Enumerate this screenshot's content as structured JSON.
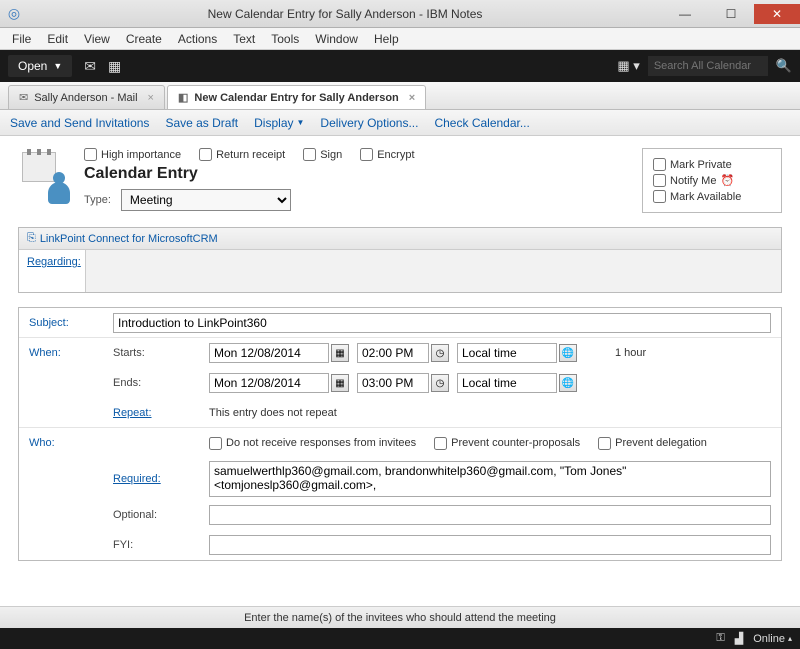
{
  "window": {
    "title": "New Calendar Entry for Sally Anderson - IBM Notes"
  },
  "menu": [
    "File",
    "Edit",
    "View",
    "Create",
    "Actions",
    "Text",
    "Tools",
    "Window",
    "Help"
  ],
  "toolbar": {
    "open_label": "Open",
    "search_placeholder": "Search All Calendar"
  },
  "tabs": [
    {
      "label": "Sally Anderson - Mail",
      "active": false
    },
    {
      "label": "New Calendar Entry for Sally Anderson",
      "active": true
    }
  ],
  "actions": {
    "save_send": "Save and Send Invitations",
    "save_draft": "Save as Draft",
    "display": "Display",
    "delivery": "Delivery Options...",
    "check_cal": "Check Calendar..."
  },
  "header": {
    "checks": {
      "high_importance": "High importance",
      "return_receipt": "Return receipt",
      "sign": "Sign",
      "encrypt": "Encrypt"
    },
    "title": "Calendar Entry",
    "type_label": "Type:",
    "type_value": "Meeting",
    "side": {
      "mark_private": "Mark Private",
      "notify_me": "Notify Me",
      "mark_available": "Mark Available"
    }
  },
  "regarding": {
    "section_title": "LinkPoint Connect for MicrosoftCRM",
    "label": "Regarding:"
  },
  "form": {
    "subject_label": "Subject:",
    "subject_value": "Introduction to LinkPoint360",
    "when_label": "When:",
    "starts_label": "Starts:",
    "ends_label": "Ends:",
    "start_date": "Mon 12/08/2014",
    "start_time": "02:00 PM",
    "end_date": "Mon 12/08/2014",
    "end_time": "03:00 PM",
    "tz": "Local time",
    "duration": "1 hour",
    "repeat_label": "Repeat:",
    "repeat_text": "This entry does not repeat",
    "who_label": "Who:",
    "who_checks": {
      "no_responses": "Do not receive responses from invitees",
      "prevent_counter": "Prevent counter-proposals",
      "prevent_delegation": "Prevent delegation"
    },
    "required_label": "Required:",
    "required_value": "samuelwerthlp360@gmail.com, brandonwhitelp360@gmail.com, \"Tom Jones\" <tomjoneslp360@gmail.com>,",
    "optional_label": "Optional:",
    "optional_value": "",
    "fyi_label": "FYI:",
    "fyi_value": ""
  },
  "status_hint": "Enter the name(s) of the invitees who should attend the meeting",
  "bottom": {
    "online": "Online"
  }
}
